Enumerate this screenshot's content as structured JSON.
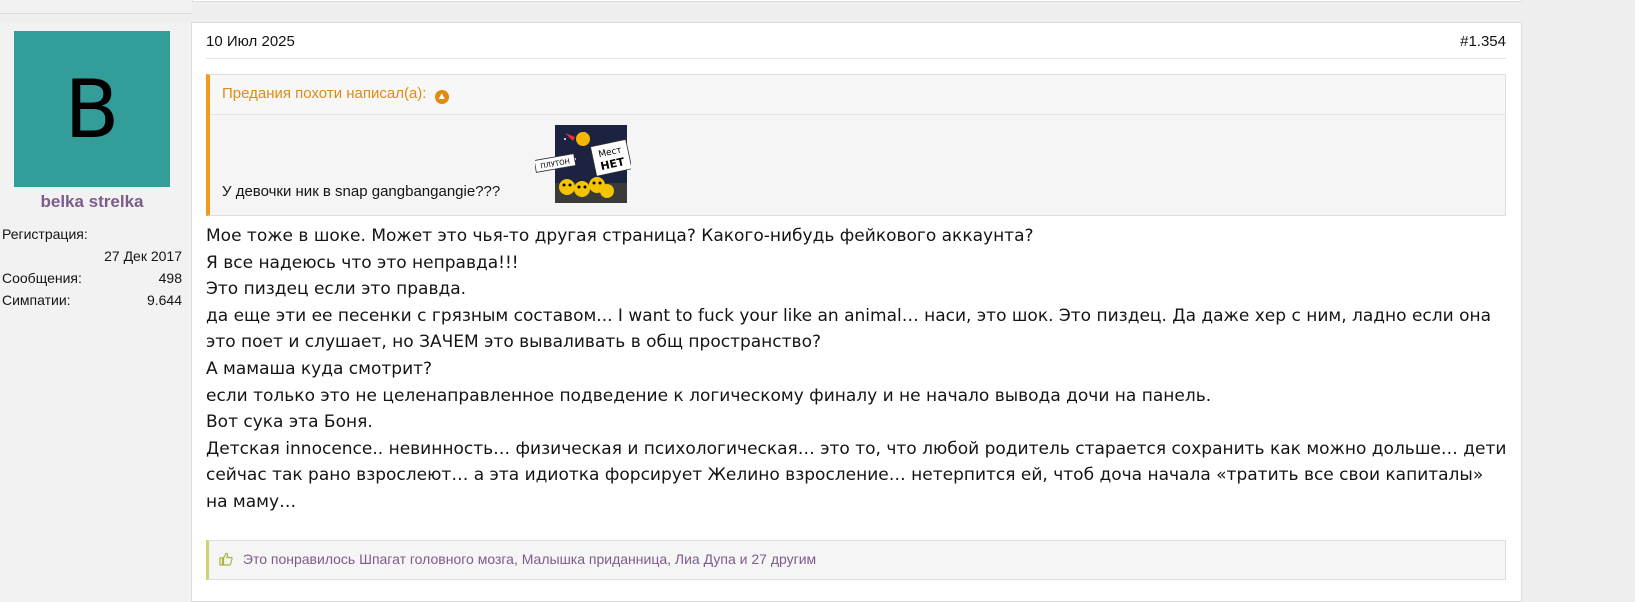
{
  "user": {
    "avatar_letter": "B",
    "avatar_color": "#339e99",
    "name": "belka strelka",
    "reg_label": "Регистрация:",
    "reg_value": "27 Дек 2017",
    "messages_label": "Сообщения:",
    "messages_value": "498",
    "likes_label": "Симпатии:",
    "likes_value": "9.644"
  },
  "post": {
    "date": "10 Июл 2025",
    "number": "#1.354",
    "quote": {
      "author_line": "Предания похоти написал(а):",
      "text": "У девочки ник в snap gangbangangie???",
      "image_caption_1": "ПЛУТОН",
      "image_caption_2": "Мест",
      "image_caption_3": "НЕТ"
    },
    "body": [
      "Мое тоже в шоке. Может это чья-то другая страница? Какого-нибудь фейкового аккаунта?",
      "Я все надеюсь что это неправда!!!",
      "Это пиздец если это правда.",
      "да еще эти ее песенки с грязным составом... I want to fuck your like an animal… наси, это шок. Это пиздец. Да даже хер с ним, ладно если она это поет и слушает, но ЗАЧЕМ это вываливать в общ пространство?",
      "А мамаша куда смотрит?",
      "если только это не целенаправленное подведение к логическому финалу и не начало вывода дочи на панель.",
      "Вот сука эта Боня.",
      "Детская innocence.. невинность… физическая и психологическая… это то, что любой родитель старается сохранить как можно дольше… дети сейчас так рано взрослеют… а эта идиотка форсирует Желино взросление… нетерпится ей, чтоб доча начала «тратить все свои капиталы» на маму…"
    ],
    "reactions": "Это понравилось Шпагат головного мозга, Малышка приданница, Лиа Дупа и 27 другим"
  },
  "colors": {
    "accent_orange": "#e08b12",
    "username_purple": "#7d5c8c",
    "reaction_bar": "#cdd36a"
  }
}
